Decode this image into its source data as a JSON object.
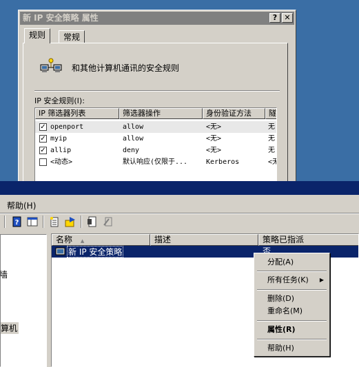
{
  "dialog": {
    "title": "新 IP 安全策略 属性",
    "help_btn": "?",
    "close_btn": "✕",
    "tabs": [
      {
        "label": "规则"
      },
      {
        "label": "常规"
      }
    ],
    "description": "和其他计算机通讯的安全规则",
    "list_label": "IP 安全规则(I):",
    "columns": [
      "IP 筛选器列表",
      "筛选器操作",
      "身份验证方法",
      "隧"
    ],
    "rows": [
      {
        "checked": "✓",
        "filter": "openport",
        "action": "allow",
        "auth": "<无>",
        "tunnel": "无"
      },
      {
        "checked": "✓",
        "filter": "myip",
        "action": "allow",
        "auth": "<无>",
        "tunnel": "无"
      },
      {
        "checked": "✓",
        "filter": "allip",
        "action": "deny",
        "auth": "<无>",
        "tunnel": "无"
      },
      {
        "checked": "",
        "filter": "<动态>",
        "action": "默认响应(仅限于...",
        "auth": "Kerberos",
        "tunnel": "<无"
      }
    ]
  },
  "console": {
    "menu_help": "帮助(H)",
    "tree": [
      {
        "label": "墙"
      },
      {
        "label": "算机"
      }
    ],
    "columns": {
      "name": "名称",
      "sort_arrow": "▲",
      "description": "描述",
      "assigned": "策略已指派"
    },
    "row": {
      "name": "新 IP 安全策略",
      "assigned": "否"
    }
  },
  "context_menu": {
    "items": [
      {
        "label": "分配(A)"
      },
      {
        "label": "所有任务(K)"
      },
      {
        "label": "删除(D)"
      },
      {
        "label": "重命名(M)"
      },
      {
        "label": "属性(R)"
      },
      {
        "label": "帮助(H)"
      }
    ],
    "submenu_arrow": "▶"
  },
  "colors": {
    "desktop": "#3a6ea5",
    "titlebar_inactive": "#808080",
    "selection": "#0a246a",
    "face": "#d4d0c8"
  }
}
